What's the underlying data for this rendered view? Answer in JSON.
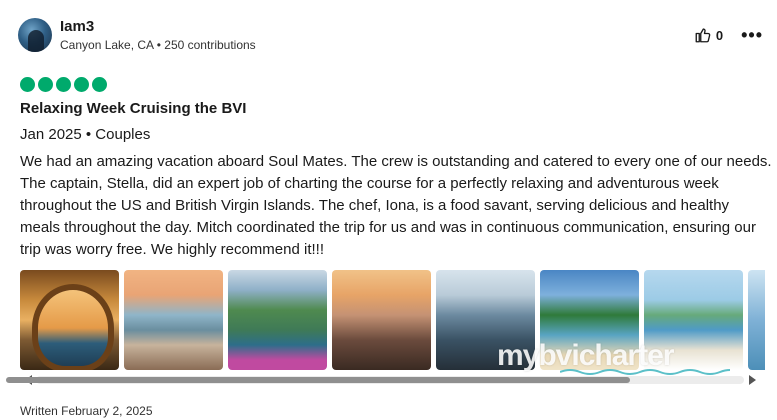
{
  "review": {
    "user": {
      "name": "Iam3",
      "location": "Canyon Lake, CA",
      "separator": " • ",
      "contributions": "250 contributions"
    },
    "helpful_votes": "0",
    "more_icon": "more-options-icon",
    "rating": {
      "value": 5,
      "max": 5,
      "color": "#00aa6c"
    },
    "title": "Relaxing Week Cruising the BVI",
    "trip_info": "Jan 2025 • Couples",
    "text": "We had an amazing vacation aboard Soul Mates. The crew is outstanding and catered to every one of our needs. The captain, Stella, did an expert job of charting the course for a perfectly relaxing and adventurous week throughout the US and British Virgin Islands. The chef, Iona, is a food savant, serving delicious and healthy meals throughout the day. Mitch coordinated the trip for us and was in continuous communication, ensuring our trip was worry free. We highly recommend it!!!",
    "photos_count": 8,
    "watermark": "mybvicharter",
    "written_date": "Written February 2, 2025"
  }
}
